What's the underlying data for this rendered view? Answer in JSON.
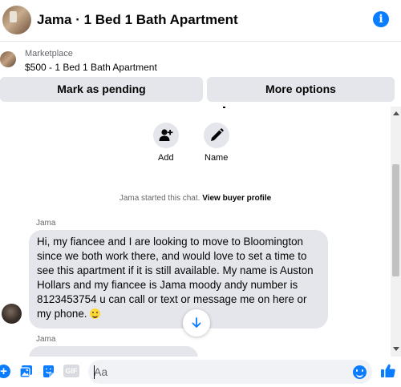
{
  "header": {
    "title": "Jama · 1 Bed 1 Bath Apartment",
    "info_icon": "info-icon"
  },
  "marketplace": {
    "label": "Marketplace",
    "listing": "$500 - 1 Bed 1 Bath Apartment"
  },
  "actions": {
    "pending_label": "Mark as pending",
    "more_label": "More options"
  },
  "contact_actions": {
    "add_label": "Add",
    "name_label": "Name"
  },
  "system": {
    "started": "Jama started this chat.",
    "view_profile": "View buyer profile"
  },
  "messages": [
    {
      "sender": "Jama",
      "text": "Hi, my fiancee and I are looking to move to Bloomington since we both work there, and would love to set a time to see this apartment if it is still available. My name is Auston Hollars and my fiancee is Jama moody andy number is 8123453754 u can call or text or message me on here or my phone."
    },
    {
      "sender": "Jama",
      "text": ""
    }
  ],
  "composer": {
    "placeholder": "Aa",
    "gif_label": "GIF"
  },
  "colors": {
    "accent": "#0a7cff",
    "bubble": "#e4e6eb",
    "secondary_text": "#65676b"
  }
}
